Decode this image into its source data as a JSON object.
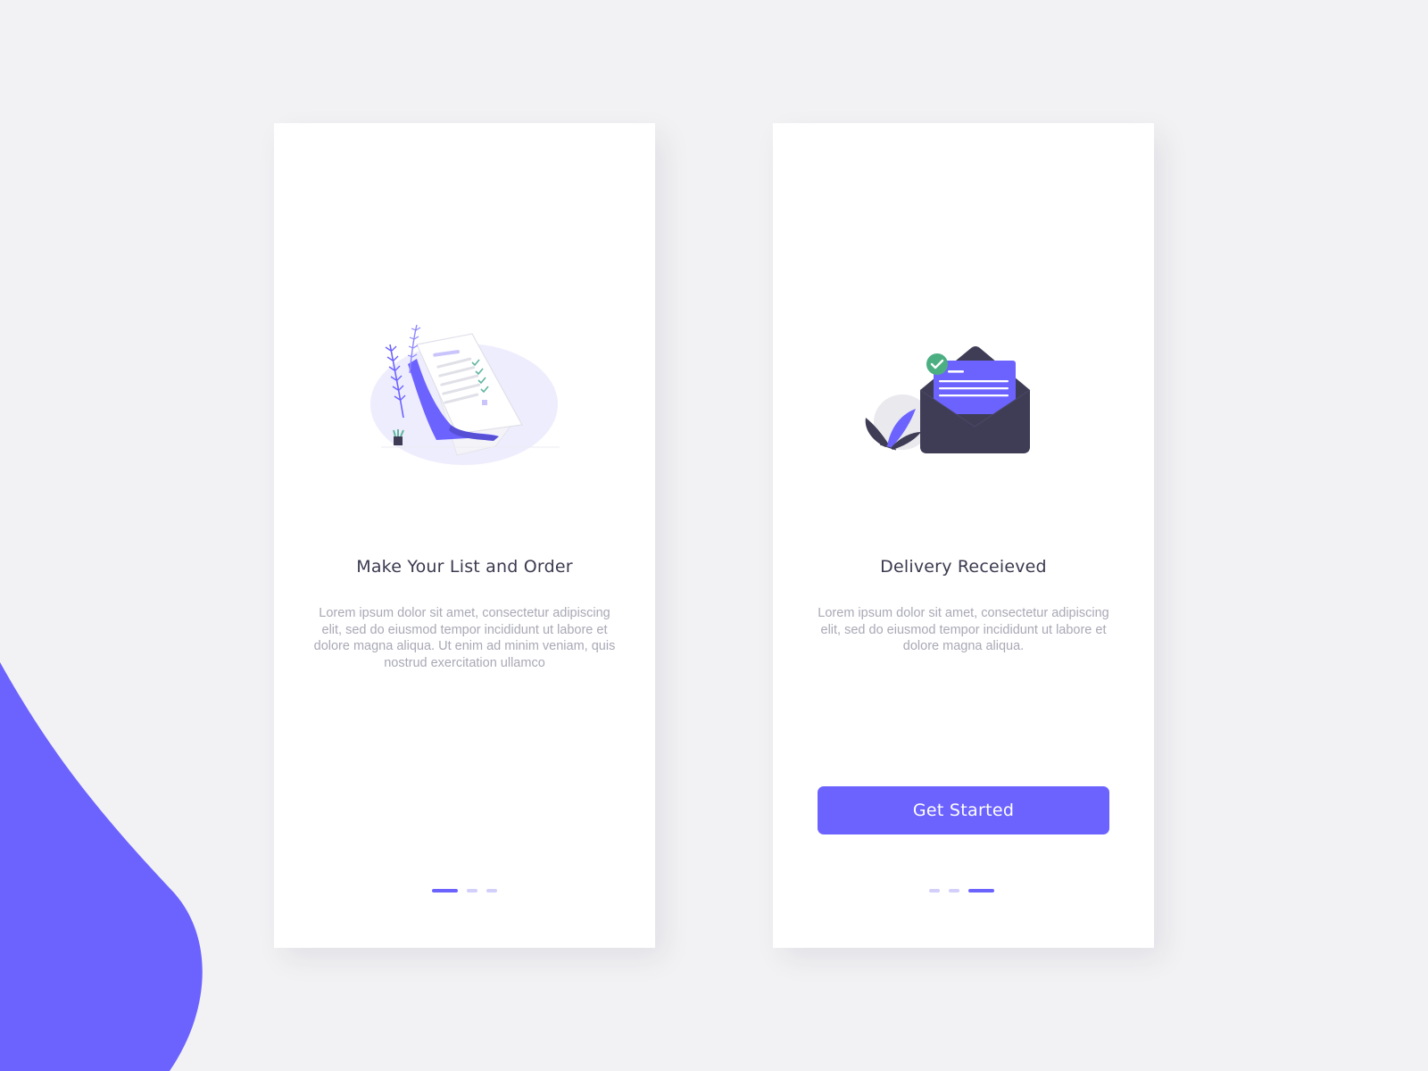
{
  "colors": {
    "accent": "#6c63ff",
    "background": "#f2f2f4",
    "card": "#ffffff",
    "title": "#3b3a4f",
    "body_text": "#a9a9b6",
    "dot_inactive": "#d2cffb",
    "envelope_dark": "#3f3d56",
    "check_green": "#4caf82"
  },
  "screens": [
    {
      "illustration_icon": "checklist-document-illustration",
      "title": "Make Your List and Order",
      "body": "Lorem ipsum dolor sit amet, consectetur adipiscing elit, sed do eiusmod tempor incididunt ut labore et dolore magna aliqua. Ut enim ad minim veniam, quis nostrud exercitation ullamco",
      "pager": {
        "total": 3,
        "active": 1
      }
    },
    {
      "illustration_icon": "envelope-check-illustration",
      "title": "Delivery Receieved",
      "body": "Lorem ipsum dolor sit amet, consectetur adipiscing elit, sed do eiusmod tempor incididunt ut labore et dolore magna aliqua.",
      "button_label": "Get Started",
      "pager": {
        "total": 3,
        "active": 3
      }
    }
  ]
}
